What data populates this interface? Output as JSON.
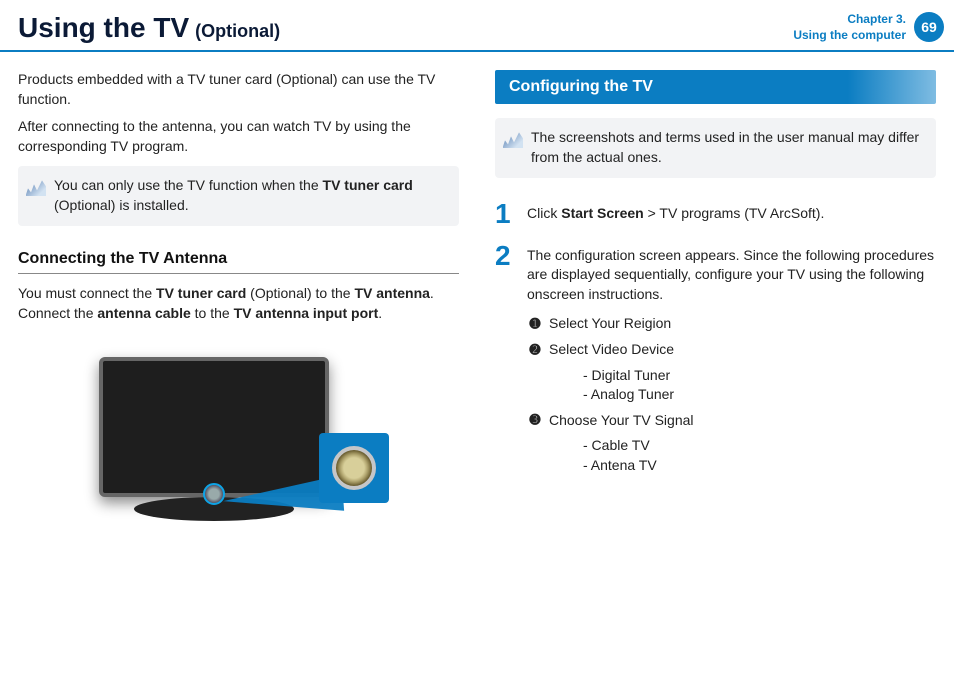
{
  "header": {
    "title_main": "Using the TV",
    "title_sub": "(Optional)",
    "chapter_line1": "Chapter 3.",
    "chapter_line2": "Using the computer",
    "page_number": "69"
  },
  "left": {
    "intro1": "Products embedded with a TV tuner card (Optional) can use the TV function.",
    "intro2": "After connecting to the antenna, you can watch TV by using the corresponding TV program.",
    "note_prefix": "You can only use the TV function when the ",
    "note_bold": "TV tuner card",
    "note_suffix": " (Optional) is installed.",
    "subheading": "Connecting the TV Antenna",
    "antenna1_a": "You must connect the ",
    "antenna1_b": "TV tuner card",
    "antenna1_c": " (Optional) to the ",
    "antenna1_d": "TV antenna",
    "antenna1_e": ". Connect the ",
    "antenna1_f": "antenna cable",
    "antenna1_g": " to the ",
    "antenna1_h": "TV antenna input port",
    "antenna1_i": "."
  },
  "right": {
    "banner": "Configuring the TV",
    "note": "The screenshots and terms used in the user manual may differ from the actual ones.",
    "step1_num": "1",
    "step1_a": "Click ",
    "step1_b": "Start Screen",
    "step1_c": " > TV programs (TV ArcSoft).",
    "step2_num": "2",
    "step2_text": "The configuration screen appears. Since the following procedures are displayed sequentially, configure your TV using the following onscreen instructions.",
    "circ1_num": "➊",
    "circ1_text": "Select Your Reigion",
    "circ2_num": "➋",
    "circ2_text": "Select Video Device",
    "circ2_sub1": "- Digital Tuner",
    "circ2_sub2": "- Analog Tuner",
    "circ3_num": "➌",
    "circ3_text": "Choose Your TV Signal",
    "circ3_sub1": "- Cable TV",
    "circ3_sub2": "- Antena TV"
  }
}
